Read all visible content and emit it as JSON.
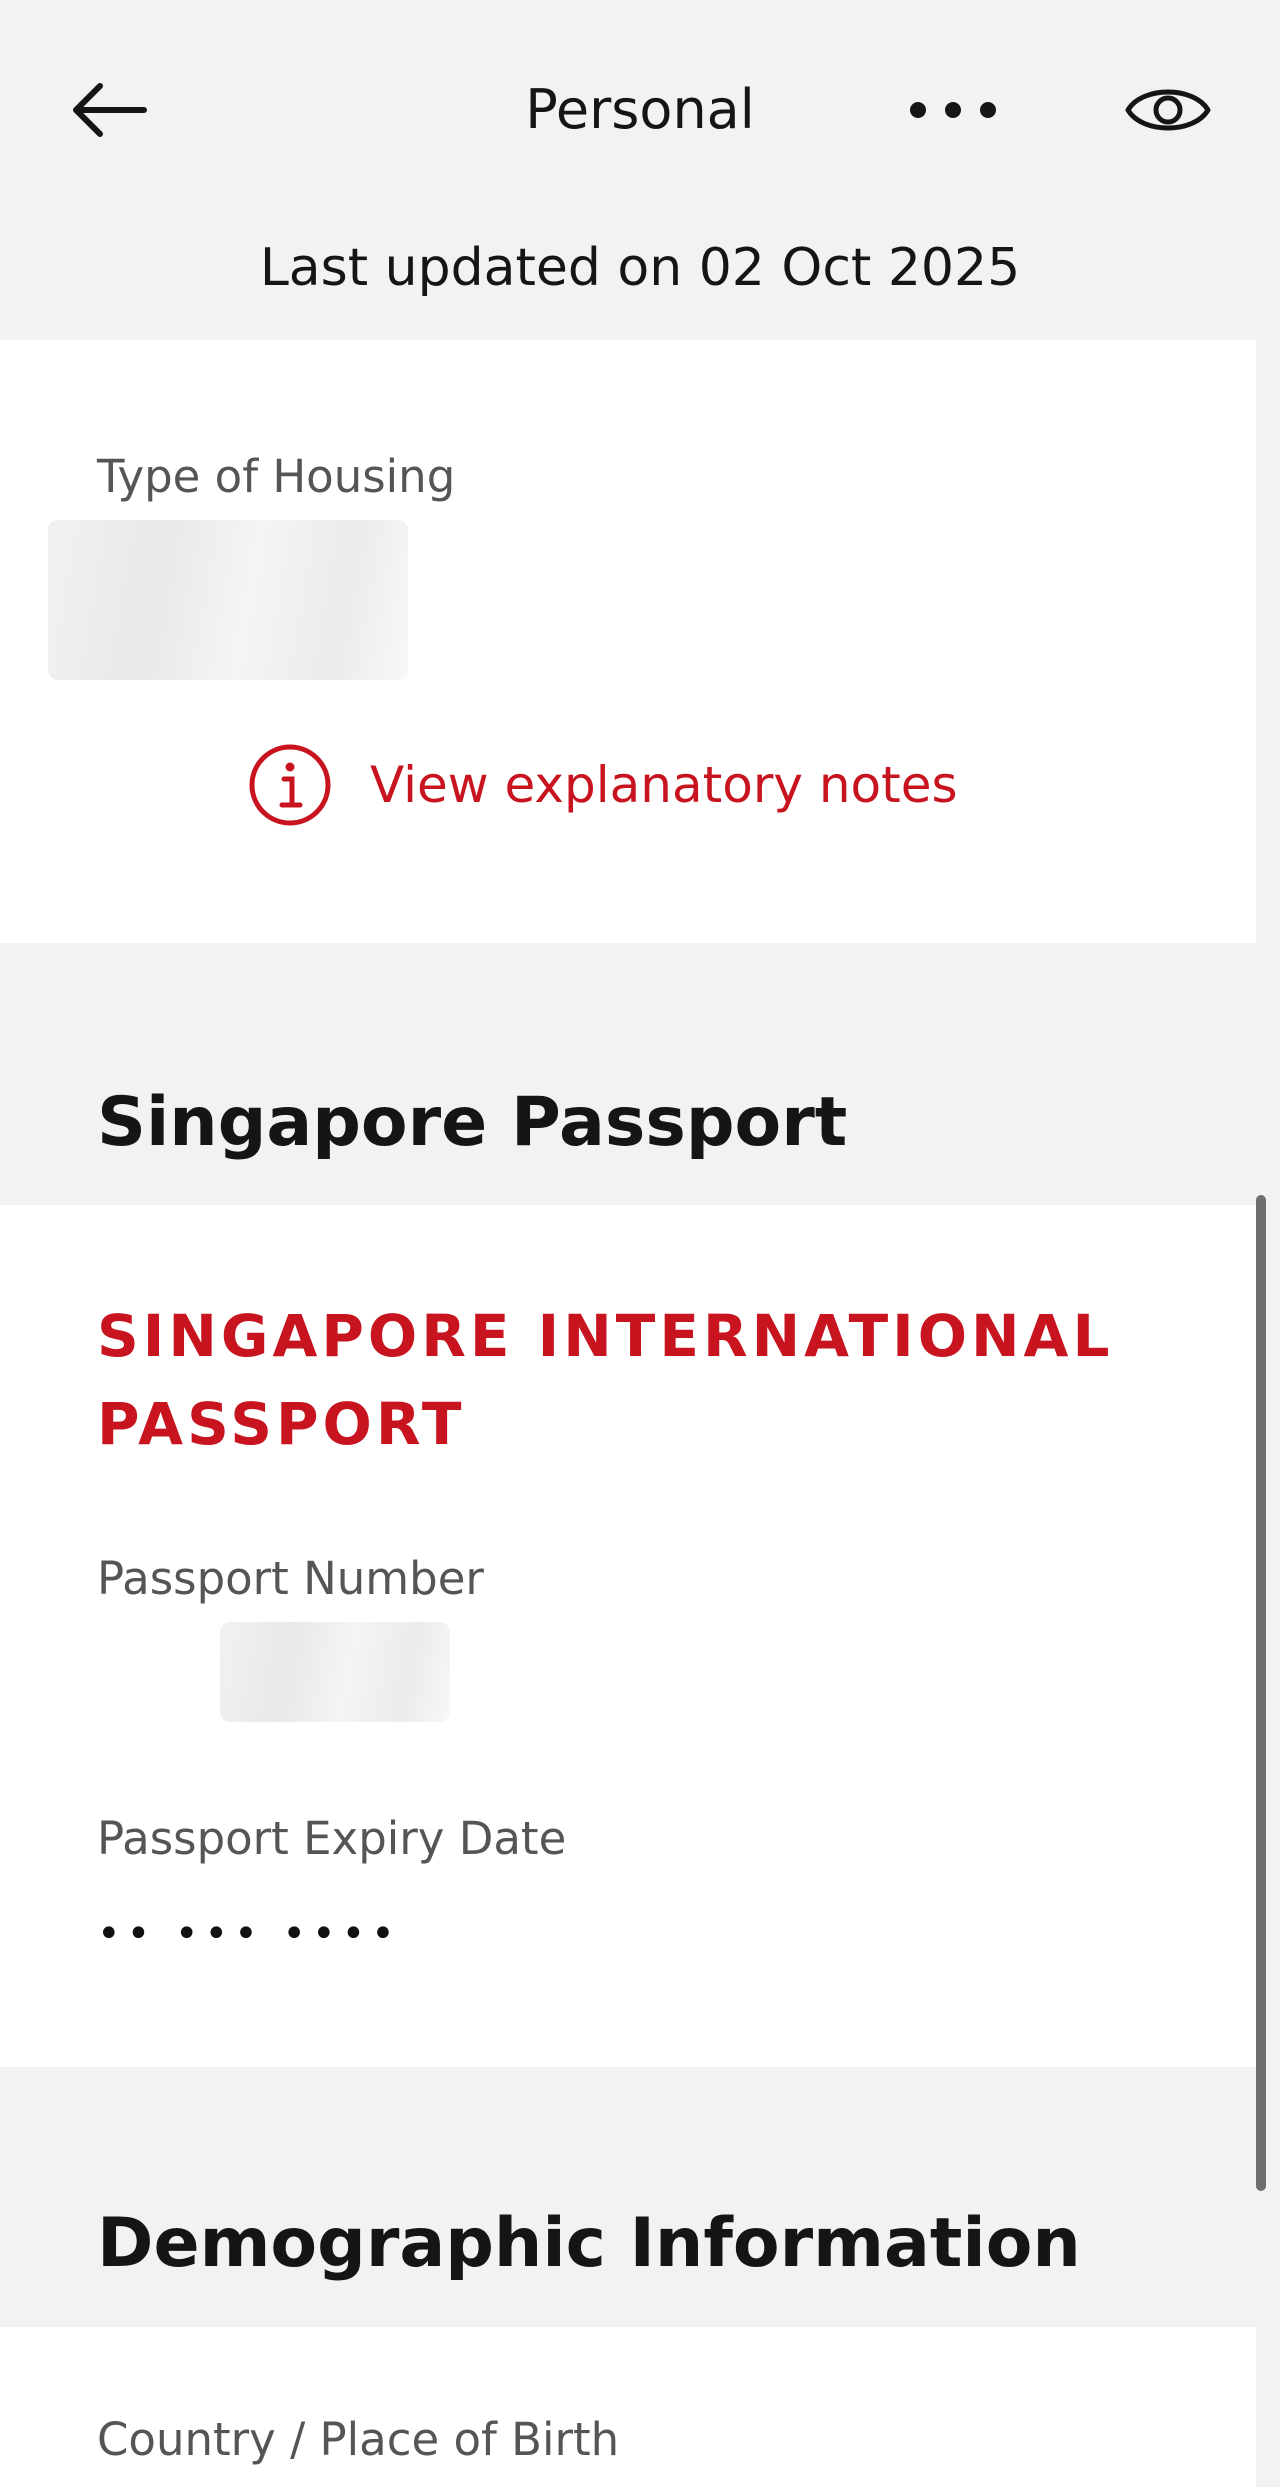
{
  "header": {
    "back_icon": "arrow-left-icon",
    "title": "Personal",
    "more_icon": "more-horizontal-icon",
    "visibility_icon": "eye-icon",
    "last_updated": "Last updated on 02 Oct 2025"
  },
  "housing": {
    "label": "Type of Housing",
    "notes_icon": "info-circle-icon",
    "notes_link": "View explanatory notes"
  },
  "passport_section": {
    "heading": "Singapore Passport",
    "document_title": "SINGAPORE INTERNATIONAL PASSPORT",
    "number_label": "Passport Number",
    "expiry_label": "Passport Expiry Date",
    "expiry_value": "•• ••• ••••"
  },
  "demographic_section": {
    "heading": "Demographic Information",
    "birth_label": "Country / Place of Birth"
  },
  "colors": {
    "accent": "#c8141f",
    "background": "#f2f2f2",
    "card": "#ffffff",
    "text": "#151515",
    "muted_text": "#555555"
  }
}
